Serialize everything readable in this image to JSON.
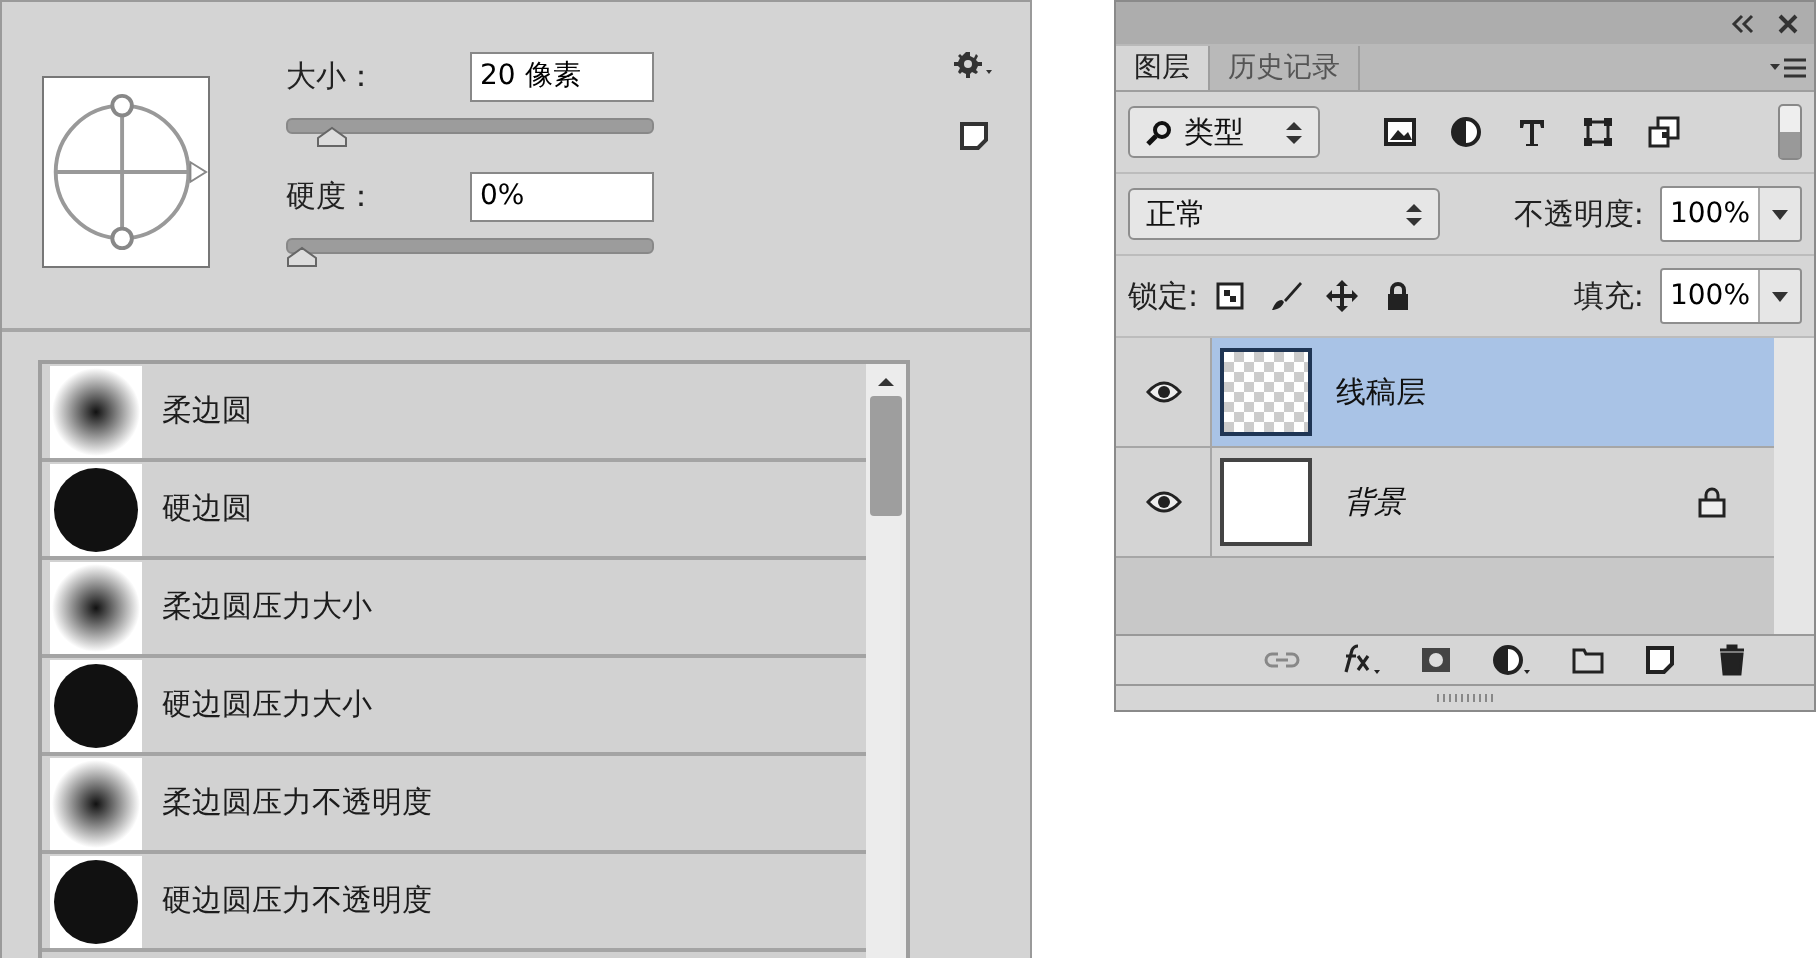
{
  "brush_panel": {
    "size": {
      "label": "大小：",
      "value": "20 像素",
      "level": 0.09
    },
    "hardness": {
      "label": "硬度：",
      "value": "0%",
      "level": 0
    },
    "brushes": [
      {
        "name": "柔边圆",
        "kind": "soft"
      },
      {
        "name": "硬边圆",
        "kind": "hard"
      },
      {
        "name": "柔边圆压力大小",
        "kind": "soft"
      },
      {
        "name": "硬边圆压力大小",
        "kind": "hard"
      },
      {
        "name": "柔边圆压力不透明度",
        "kind": "soft"
      },
      {
        "name": "硬边圆压力不透明度",
        "kind": "hard"
      }
    ]
  },
  "layers_panel": {
    "tabs": [
      {
        "label": "图层",
        "selected": true
      },
      {
        "label": "历史记录",
        "selected": false
      }
    ],
    "filter": {
      "value": "类型",
      "on": true
    },
    "blend_mode": {
      "value": "正常"
    },
    "opacity": {
      "label": "不透明度:",
      "value": "100%"
    },
    "lock": {
      "label": "锁定:"
    },
    "fill": {
      "label": "填充:",
      "value": "100%"
    },
    "layers": [
      {
        "name": "线稿层",
        "selected": true,
        "visible": true,
        "locked": false,
        "kind": "transparent"
      },
      {
        "name": "背景",
        "selected": false,
        "visible": true,
        "locked": true,
        "kind": "white"
      }
    ]
  }
}
